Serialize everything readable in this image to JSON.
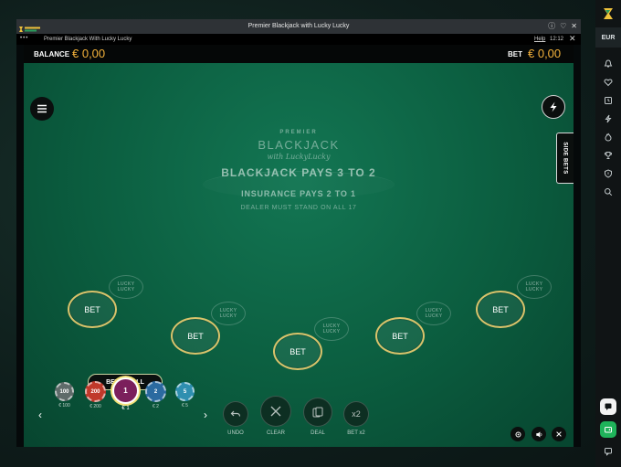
{
  "window": {
    "title": "Premier Blackjack with Lucky Lucky",
    "game_name": "Premier Blackjack With Lucky Lucky",
    "help_label": "Help",
    "clock": "12:12",
    "menu_dots": "•••",
    "close_glyph": "✕"
  },
  "balance_bar": {
    "balance_label": "BALANCE",
    "balance_value": "€ 0,00",
    "bet_label": "BET",
    "bet_value": "€ 0,00"
  },
  "table": {
    "side_bets_label": "SIDE BETS",
    "felt": {
      "premier": "PREMIER",
      "blackjack": "BLACKJACK",
      "with": "with LuckyLucky",
      "pays": "BLACKJACK PAYS 3 TO 2",
      "insurance": "INSURANCE PAYS 2 TO 1",
      "dealer": "DEALER MUST STAND ON ALL 17"
    },
    "bet_spot_label": "BET",
    "lucky_line1": "LUCKY",
    "lucky_line2": "LUCKY",
    "bet_on_all_label": "BET ON ALL"
  },
  "chips": [
    {
      "value": "100",
      "label": "€ 100",
      "color": "#5f6b6a",
      "selected": false
    },
    {
      "value": "200",
      "label": "€ 200",
      "color": "#c0392b",
      "selected": false
    },
    {
      "value": "1",
      "label": "€ 1",
      "color": "#7b1f5c",
      "selected": true
    },
    {
      "value": "2",
      "label": "€ 2",
      "color": "#2b6aa0",
      "selected": false
    },
    {
      "value": "5",
      "label": "€ 5",
      "color": "#2f8fb0",
      "selected": false
    }
  ],
  "actions": {
    "undo": "UNDO",
    "clear": "CLEAR",
    "deal": "DEAL",
    "bet_x2": "BET x2",
    "x2_glyph": "x2"
  },
  "rail": {
    "currency": "EUR"
  },
  "colors": {
    "accent": "#f4b23b",
    "felt": "#0b5d3f",
    "rail_green": "#1fb35a"
  }
}
